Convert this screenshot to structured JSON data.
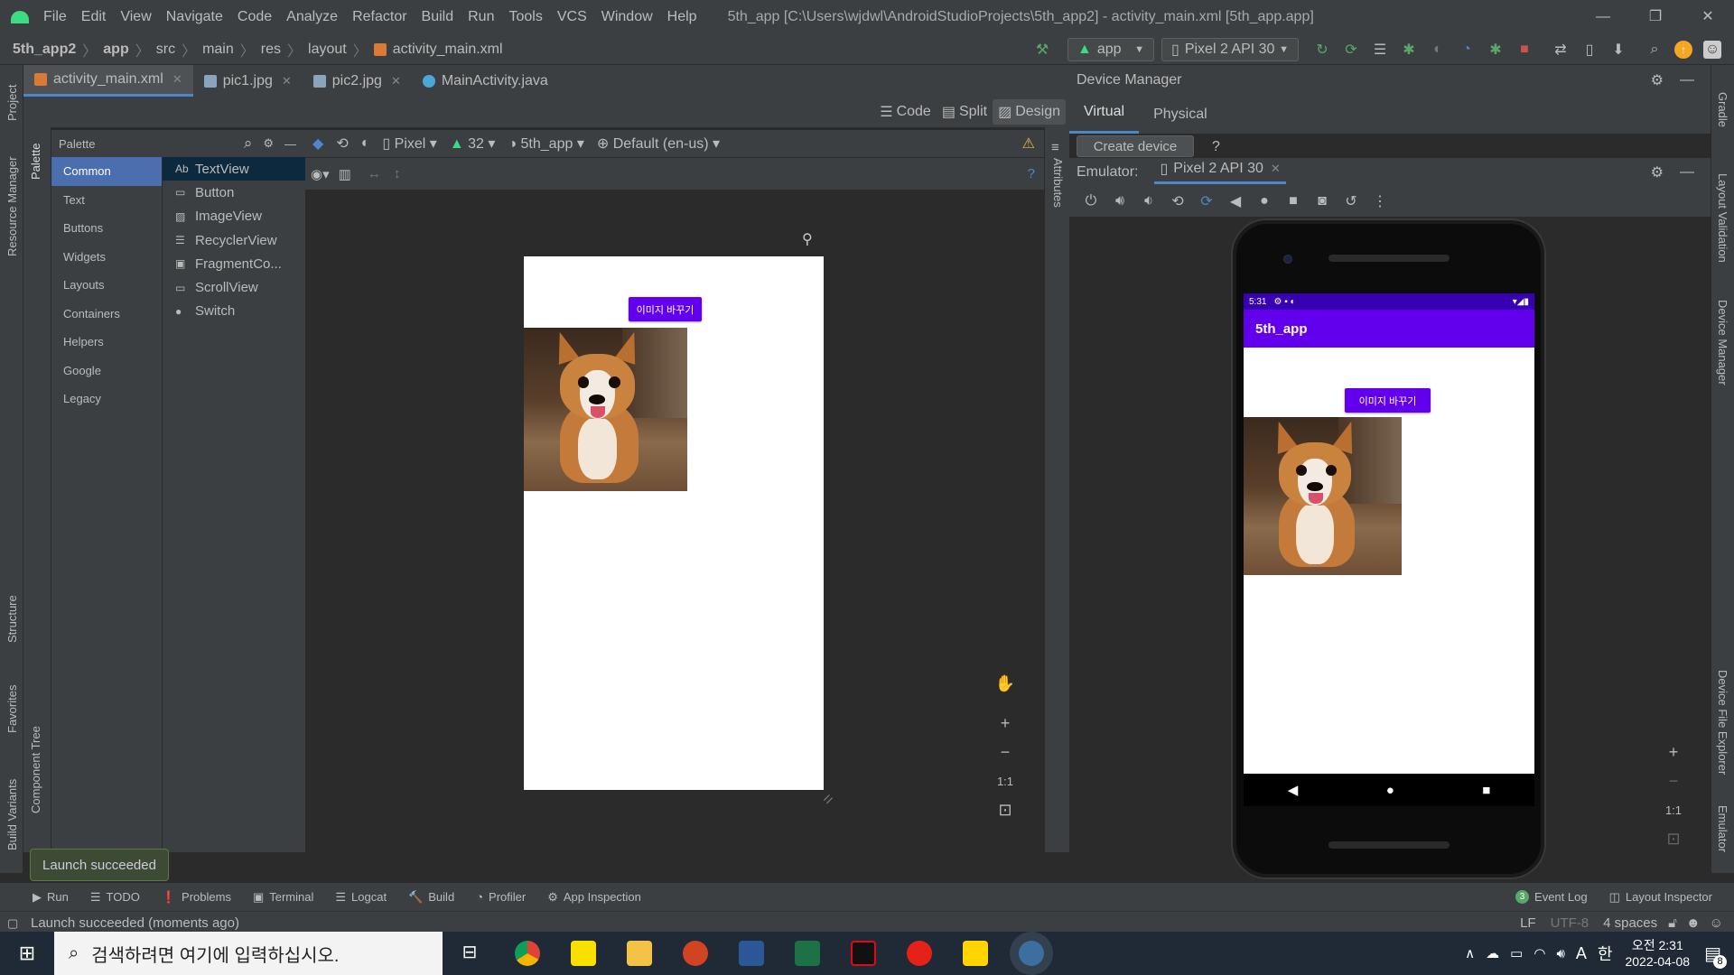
{
  "menu": [
    "File",
    "Edit",
    "View",
    "Navigate",
    "Code",
    "Analyze",
    "Refactor",
    "Build",
    "Run",
    "Tools",
    "VCS",
    "Window",
    "Help"
  ],
  "window_title": "5th_app [C:\\Users\\wjdwl\\AndroidStudioProjects\\5th_app2] - activity_main.xml [5th_app.app]",
  "breadcrumbs": [
    "5th_app2",
    "app",
    "src",
    "main",
    "res",
    "layout",
    "activity_main.xml"
  ],
  "toolbar": {
    "run_config": "app",
    "device": "Pixel 2 API 30"
  },
  "editor_tabs": [
    {
      "label": "activity_main.xml",
      "icon": "layout-file-icon",
      "color": "#d97b36"
    },
    {
      "label": "pic1.jpg",
      "icon": "image-file-icon",
      "color": "#8aa4bd"
    },
    {
      "label": "pic2.jpg",
      "icon": "image-file-icon",
      "color": "#8aa4bd"
    },
    {
      "label": "MainActivity.java",
      "icon": "java-class-icon",
      "color": "#4aa8d8"
    }
  ],
  "view_modes": [
    "Code",
    "Split",
    "Design"
  ],
  "palette": {
    "title": "Palette",
    "categories": [
      "Common",
      "Text",
      "Buttons",
      "Widgets",
      "Layouts",
      "Containers",
      "Helpers",
      "Google",
      "Legacy"
    ],
    "items": [
      {
        "icon": "Ab",
        "label": "TextView"
      },
      {
        "icon": "▭",
        "label": "Button"
      },
      {
        "icon": "▨",
        "label": "ImageView"
      },
      {
        "icon": "☰",
        "label": "RecyclerView"
      },
      {
        "icon": "▣",
        "label": "FragmentCo..."
      },
      {
        "icon": "▭",
        "label": "ScrollView"
      },
      {
        "icon": "●",
        "label": "Switch"
      }
    ]
  },
  "design_toolbar": {
    "device": "Pixel",
    "api": "32",
    "theme": "5th_app",
    "locale": "Default (en-us)"
  },
  "preview": {
    "button_label": "이미지 바꾸기"
  },
  "zoom_controls": {
    "fit_label": "1:1"
  },
  "left_strip": [
    "Project",
    "Resource Manager",
    "Structure",
    "Favorites",
    "Build Variants"
  ],
  "left_sub_strip": [
    "Palette",
    "Component Tree"
  ],
  "right_strip": [
    "Gradle",
    "Layout Validation",
    "Device Manager",
    "Device File Explorer",
    "Emulator"
  ],
  "attributes_label": "Attributes",
  "device_manager": {
    "title": "Device Manager",
    "tabs": [
      "Virtual",
      "Physical"
    ],
    "create_button": "Create device",
    "help": "?"
  },
  "emulator": {
    "label": "Emulator:",
    "tab": "Pixel 2 API 30",
    "status_time": "5:31",
    "app_title": "5th_app",
    "button_label": "이미지 바꾸기"
  },
  "bottom_tools": [
    {
      "icon": "▶",
      "label": "Run"
    },
    {
      "icon": "☰",
      "label": "TODO"
    },
    {
      "icon": "❗",
      "label": "Problems"
    },
    {
      "icon": "▣",
      "label": "Terminal"
    },
    {
      "icon": "☰",
      "label": "Logcat"
    },
    {
      "icon": "🔨",
      "label": "Build"
    },
    {
      "icon": "◔",
      "label": "Profiler"
    },
    {
      "icon": "⚙",
      "label": "App Inspection"
    }
  ],
  "right_tools": [
    {
      "label": "Event Log",
      "badge": "3"
    },
    {
      "label": "Layout Inspector"
    }
  ],
  "toast": "Launch succeeded",
  "status": {
    "message": "Launch succeeded (moments ago)",
    "line_sep": "LF",
    "encoding": "UTF-8",
    "indent": "4 spaces"
  },
  "taskbar": {
    "search_placeholder": "검색하려면 여기에 입력하십시오.",
    "ime_a": "A",
    "ime_lang": "한",
    "time": "오전 2:31",
    "date": "2022-04-08",
    "notify_count": "8"
  },
  "colors": {
    "accent": "#6200ee",
    "status_dark": "#3700b3",
    "ide_bg": "#3c3f41",
    "editor_bg": "#2b2b2b",
    "selection": "#4b6eaf"
  }
}
